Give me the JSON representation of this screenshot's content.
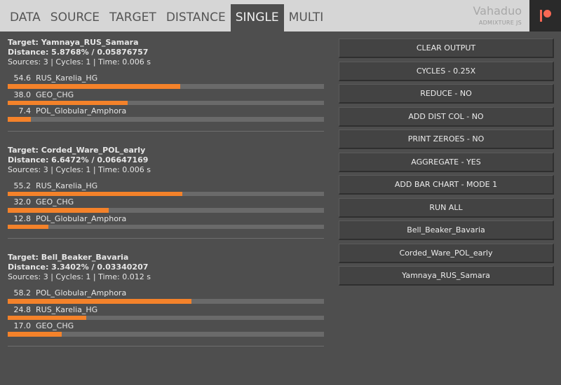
{
  "nav": {
    "tabs": [
      "DATA",
      "SOURCE",
      "TARGET",
      "DISTANCE",
      "SINGLE",
      "MULTI"
    ],
    "active_index": 4
  },
  "brand": {
    "name": "Vahaduo",
    "subtitle": "ADMIXTURE JS"
  },
  "colors": {
    "bar": "#f4822a",
    "track": "#6a6a6a",
    "patreon": "#f96854"
  },
  "results": [
    {
      "target": "Target: Yamnaya_RUS_Samara",
      "distance": "Distance: 5.8768% / 0.05876757",
      "meta": "Sources: 3 | Cycles: 1 | Time: 0.006 s",
      "sources": [
        {
          "pct": "54.6",
          "name": "RUS_Karelia_HG",
          "value": 54.6
        },
        {
          "pct": "38.0",
          "name": "GEO_CHG",
          "value": 38.0
        },
        {
          "pct": "7.4",
          "name": "POL_Globular_Amphora",
          "value": 7.4
        }
      ]
    },
    {
      "target": "Target: Corded_Ware_POL_early",
      "distance": "Distance: 6.6472% / 0.06647169",
      "meta": "Sources: 3 | Cycles: 1 | Time: 0.006 s",
      "sources": [
        {
          "pct": "55.2",
          "name": "RUS_Karelia_HG",
          "value": 55.2
        },
        {
          "pct": "32.0",
          "name": "GEO_CHG",
          "value": 32.0
        },
        {
          "pct": "12.8",
          "name": "POL_Globular_Amphora",
          "value": 12.8
        }
      ]
    },
    {
      "target": "Target: Bell_Beaker_Bavaria",
      "distance": "Distance: 3.3402% / 0.03340207",
      "meta": "Sources: 3 | Cycles: 1 | Time: 0.012 s",
      "sources": [
        {
          "pct": "58.2",
          "name": "POL_Globular_Amphora",
          "value": 58.2
        },
        {
          "pct": "24.8",
          "name": "RUS_Karelia_HG",
          "value": 24.8
        },
        {
          "pct": "17.0",
          "name": "GEO_CHG",
          "value": 17.0
        }
      ]
    }
  ],
  "buttons": [
    "CLEAR OUTPUT",
    "CYCLES - 0.25X",
    "REDUCE - NO",
    "ADD DIST COL - NO",
    "PRINT ZEROES - NO",
    "AGGREGATE - YES",
    "ADD BAR CHART - MODE 1",
    "RUN ALL",
    "Bell_Beaker_Bavaria",
    "Corded_Ware_POL_early",
    "Yamnaya_RUS_Samara"
  ]
}
